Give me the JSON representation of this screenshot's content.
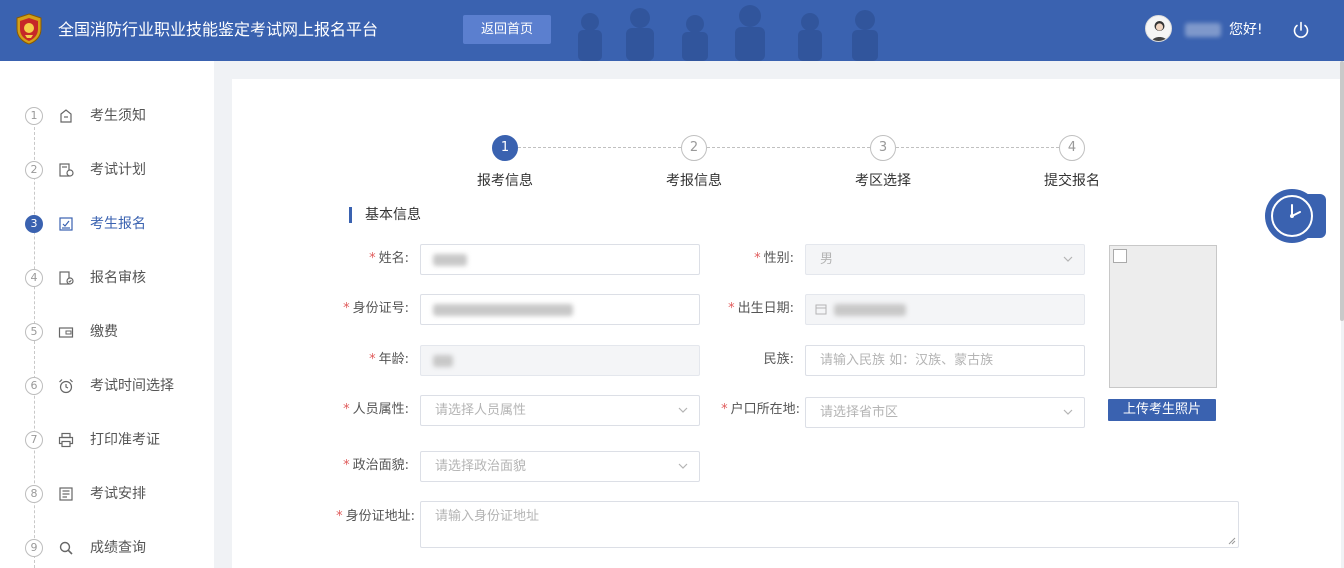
{
  "header": {
    "title": "全国消防行业职业技能鉴定考试网上报名平台",
    "home_button": "返回首页",
    "greeting": "您好!"
  },
  "sidebar": {
    "items": [
      {
        "num": "1",
        "label": "考生须知",
        "icon": "notice-icon"
      },
      {
        "num": "2",
        "label": "考试计划",
        "icon": "plan-icon"
      },
      {
        "num": "3",
        "label": "考生报名",
        "icon": "signup-icon",
        "active": true
      },
      {
        "num": "4",
        "label": "报名审核",
        "icon": "review-icon"
      },
      {
        "num": "5",
        "label": "缴费",
        "icon": "payment-icon"
      },
      {
        "num": "6",
        "label": "考试时间选择",
        "icon": "alarm-clock-icon"
      },
      {
        "num": "7",
        "label": "打印准考证",
        "icon": "printer-icon"
      },
      {
        "num": "8",
        "label": "考试安排",
        "icon": "schedule-icon"
      },
      {
        "num": "9",
        "label": "成绩查询",
        "icon": "search-icon"
      }
    ]
  },
  "steps": [
    {
      "num": "1",
      "label": "报考信息",
      "active": true
    },
    {
      "num": "2",
      "label": "考报信息"
    },
    {
      "num": "3",
      "label": "考区选择"
    },
    {
      "num": "4",
      "label": "提交报名"
    }
  ],
  "form": {
    "section_title": "基本信息",
    "name": {
      "label": "姓名:"
    },
    "gender": {
      "label": "性别:",
      "value": "男"
    },
    "id_number": {
      "label": "身份证号:"
    },
    "birth_date": {
      "label": "出生日期:"
    },
    "age": {
      "label": "年龄:"
    },
    "ethnicity": {
      "label": "民族:",
      "placeholder": "请输入民族 如：汉族、蒙古族"
    },
    "personnel_attr": {
      "label": "人员属性:",
      "placeholder": "请选择人员属性"
    },
    "household": {
      "label": "户口所在地:",
      "placeholder": "请选择省市区"
    },
    "political": {
      "label": "政治面貌:",
      "placeholder": "请选择政治面貌"
    },
    "id_address": {
      "label": "身份证地址:",
      "placeholder": "请输入身份证地址"
    },
    "upload_button": "上传考生照片"
  },
  "colors": {
    "primary": "#3a62b0",
    "required": "#e05a5a"
  }
}
